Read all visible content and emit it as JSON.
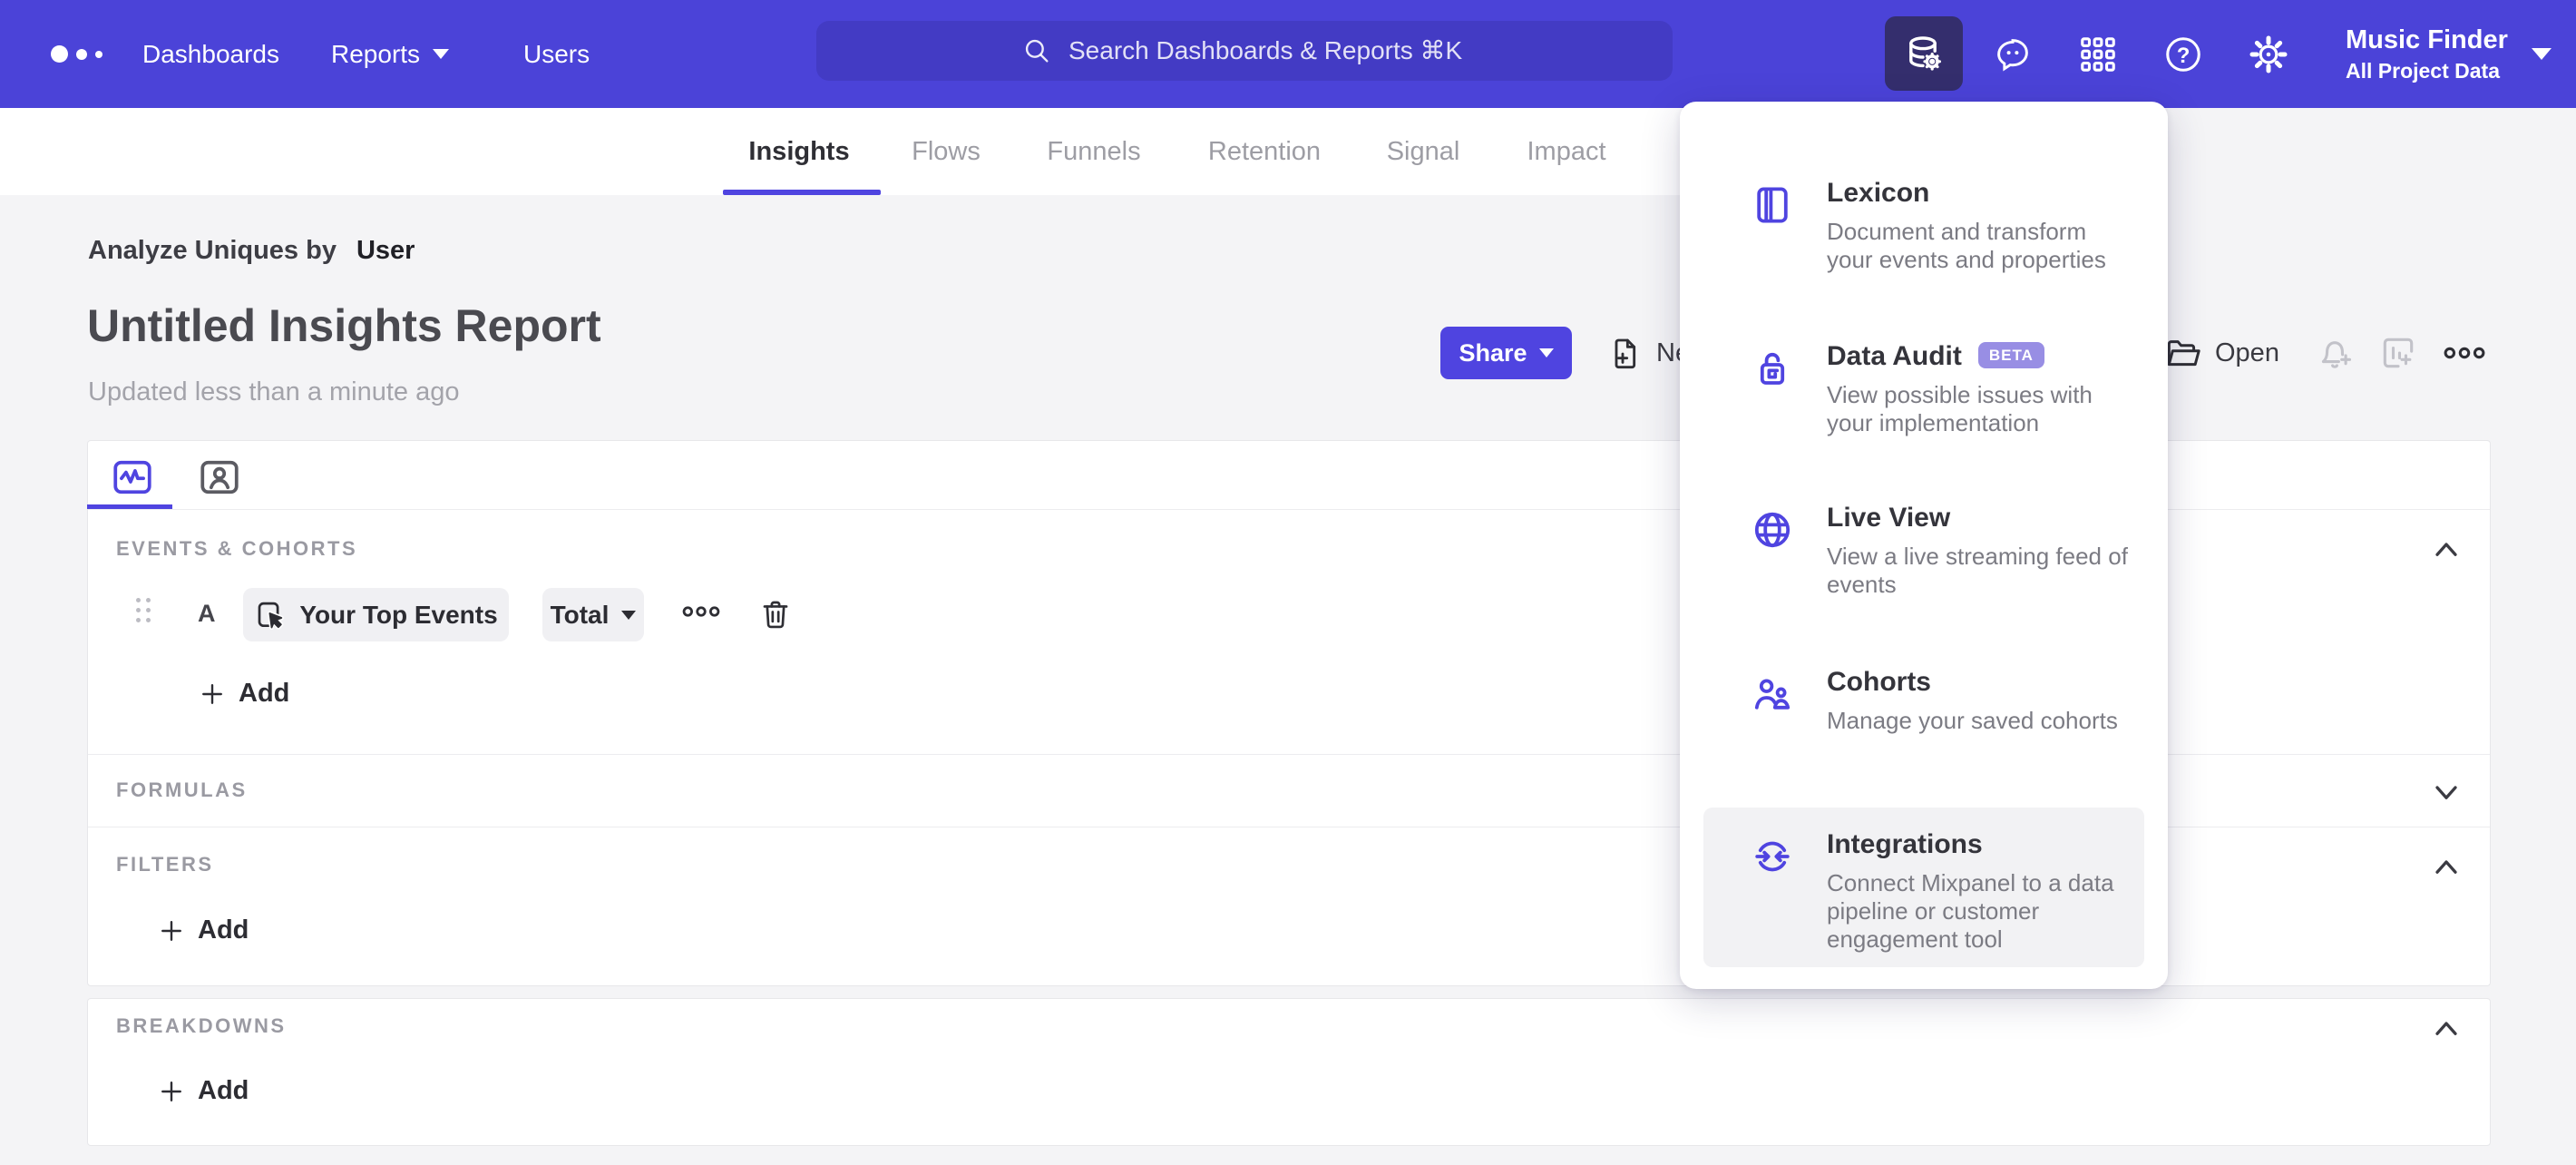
{
  "colors": {
    "header": "#4b43d8",
    "accent": "#4f44e0",
    "beta_badge": "#988ee4",
    "page_bg": "#f4f4f6"
  },
  "header": {
    "logo": "mixpanel-dots-logo",
    "nav": [
      {
        "label": "Dashboards"
      },
      {
        "label": "Reports",
        "has_caret": true
      },
      {
        "label": "Users"
      }
    ],
    "search": {
      "placeholder": "Search Dashboards & Reports ⌘K",
      "icon": "search-icon"
    },
    "icons": [
      "data-management-icon",
      "feedback-icon",
      "apps-grid-icon",
      "help-icon",
      "settings-icon"
    ],
    "project": {
      "name": "Music Finder",
      "scope": "All Project Data"
    }
  },
  "report_tabs": [
    {
      "label": "Insights",
      "active": true
    },
    {
      "label": "Flows",
      "active": false
    },
    {
      "label": "Funnels",
      "active": false
    },
    {
      "label": "Retention",
      "active": false
    },
    {
      "label": "Signal",
      "active": false
    },
    {
      "label": "Impact",
      "active": false
    }
  ],
  "report": {
    "analyze_prefix": "Analyze Uniques by",
    "analyze_value": "User",
    "title": "Untitled Insights Report",
    "updated": "Updated less than a minute ago",
    "actions": {
      "share": "Share",
      "new": "New",
      "open": "Open"
    }
  },
  "builder": {
    "events": {
      "label": "EVENTS & COHORTS",
      "row": {
        "letter": "A",
        "event": "Your Top Events",
        "aggregation": "Total"
      },
      "add_label": "Add"
    },
    "formulas": {
      "label": "FORMULAS"
    },
    "filters": {
      "label": "FILTERS",
      "add_label": "Add"
    },
    "breakdowns": {
      "label": "BREAKDOWNS",
      "add_label": "Add"
    }
  },
  "data_menu": {
    "items": [
      {
        "icon": "lexicon-book-icon",
        "title": "Lexicon",
        "description": "Document and transform your events and properties"
      },
      {
        "icon": "data-audit-lock-icon",
        "title": "Data Audit",
        "badge": "BETA",
        "description": "View possible issues with your implementation"
      },
      {
        "icon": "live-view-globe-icon",
        "title": "Live View",
        "description": "View a live streaming feed of events"
      },
      {
        "icon": "cohorts-users-icon",
        "title": "Cohorts",
        "description": "Manage your saved cohorts"
      },
      {
        "icon": "integrations-sync-icon",
        "title": "Integrations",
        "description": "Connect Mixpanel to a data pipeline or customer engagement tool",
        "highlighted": true
      }
    ]
  }
}
